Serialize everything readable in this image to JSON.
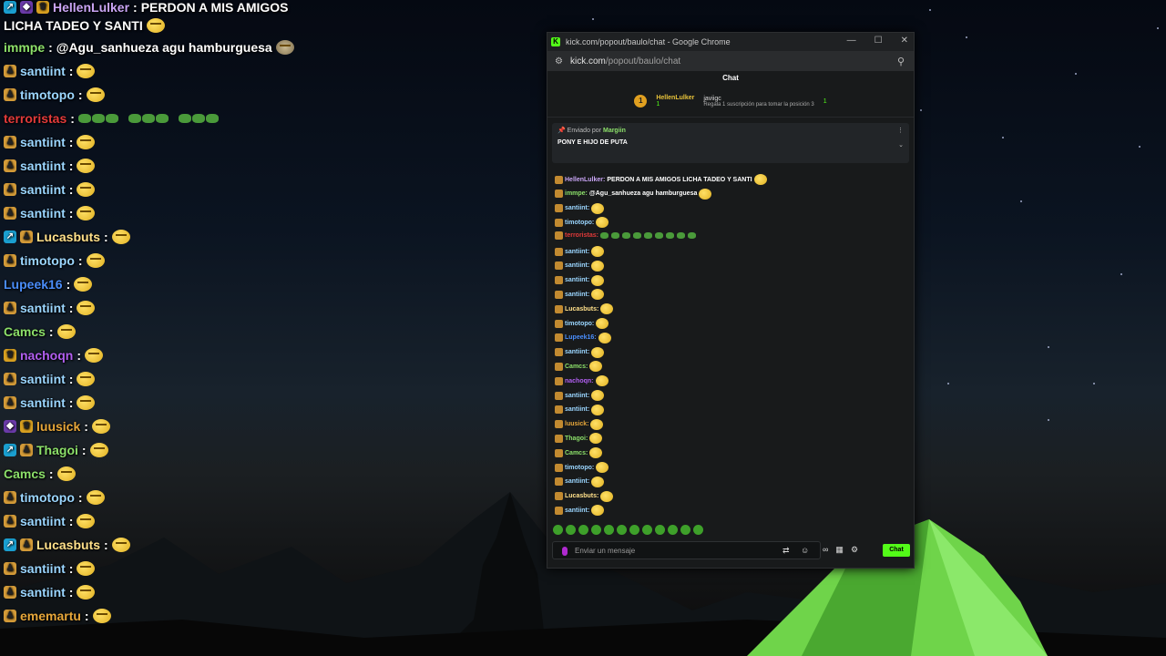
{
  "overlay": [
    {
      "badges": [
        "og",
        "gift",
        "crown"
      ],
      "user": "HellenLulker",
      "color": "#c9a5f5",
      "msg": "PERDON A MIS AMIGOS",
      "msg2": "LICHA TADEO Y SANTI",
      "emote": "smile"
    },
    {
      "badges": [],
      "user": "immpe",
      "color": "#8ce06a",
      "msg": "@Agu_sanhueza agu hamburguesa",
      "emote": "turtle"
    },
    {
      "badges": [
        "vip"
      ],
      "user": "santiint",
      "color": "#9bd6ff",
      "msg": "",
      "emote": "smile"
    },
    {
      "badges": [
        "vip"
      ],
      "user": "timotopo",
      "color": "#9bd6ff",
      "msg": "",
      "emote": "smile"
    },
    {
      "badges": [],
      "user": "terroristas",
      "color": "#e33a3a",
      "msg": "",
      "emote": "frogs"
    },
    {
      "badges": [
        "vip"
      ],
      "user": "santiint",
      "color": "#9bd6ff",
      "msg": "",
      "emote": "smile"
    },
    {
      "badges": [
        "vip"
      ],
      "user": "santiint",
      "color": "#9bd6ff",
      "msg": "",
      "emote": "smile"
    },
    {
      "badges": [
        "vip"
      ],
      "user": "santiint",
      "color": "#9bd6ff",
      "msg": "",
      "emote": "smile"
    },
    {
      "badges": [
        "vip"
      ],
      "user": "santiint",
      "color": "#9bd6ff",
      "msg": "",
      "emote": "smile"
    },
    {
      "badges": [
        "og",
        "vip"
      ],
      "user": "Lucasbuts",
      "color": "#ffe08a",
      "msg": "",
      "emote": "smile"
    },
    {
      "badges": [
        "vip"
      ],
      "user": "timotopo",
      "color": "#9bd6ff",
      "msg": "",
      "emote": "smile"
    },
    {
      "badges": [],
      "user": "Lupeek16",
      "color": "#4a8dfa",
      "msg": "",
      "emote": "smile"
    },
    {
      "badges": [
        "vip"
      ],
      "user": "santiint",
      "color": "#9bd6ff",
      "msg": "",
      "emote": "smile"
    },
    {
      "badges": [],
      "user": "Camcs",
      "color": "#8ce06a",
      "msg": "",
      "emote": "smile"
    },
    {
      "badges": [
        "crown"
      ],
      "user": "nachoqn",
      "color": "#b15ff0",
      "msg": "",
      "emote": "smile"
    },
    {
      "badges": [
        "vip"
      ],
      "user": "santiint",
      "color": "#9bd6ff",
      "msg": "",
      "emote": "smile"
    },
    {
      "badges": [
        "vip"
      ],
      "user": "santiint",
      "color": "#9bd6ff",
      "msg": "",
      "emote": "smile"
    },
    {
      "badges": [
        "gift",
        "crown"
      ],
      "user": "luusick",
      "color": "#e7a73a",
      "msg": "",
      "emote": "smile"
    },
    {
      "badges": [
        "og",
        "vip"
      ],
      "user": "Thagoi",
      "color": "#8ce06a",
      "msg": "",
      "emote": "smile"
    },
    {
      "badges": [],
      "user": "Camcs",
      "color": "#8ce06a",
      "msg": "",
      "emote": "smile"
    },
    {
      "badges": [
        "vip"
      ],
      "user": "timotopo",
      "color": "#9bd6ff",
      "msg": "",
      "emote": "smile"
    },
    {
      "badges": [
        "vip"
      ],
      "user": "santiint",
      "color": "#9bd6ff",
      "msg": "",
      "emote": "smile"
    },
    {
      "badges": [
        "og",
        "vip"
      ],
      "user": "Lucasbuts",
      "color": "#ffe08a",
      "msg": "",
      "emote": "smile"
    },
    {
      "badges": [
        "vip"
      ],
      "user": "santiint",
      "color": "#9bd6ff",
      "msg": "",
      "emote": "smile"
    },
    {
      "badges": [
        "vip"
      ],
      "user": "santiint",
      "color": "#9bd6ff",
      "msg": "",
      "emote": "smile"
    },
    {
      "badges": [
        "vip"
      ],
      "user": "ememartu",
      "color": "#e7a73a",
      "msg": "",
      "emote": "smile"
    }
  ],
  "window": {
    "title": "kick.com/popout/baulo/chat - Google Chrome",
    "url_host": "kick.com",
    "url_path": "/popout/baulo/chat",
    "chat_header": "Chat",
    "leaderboard": {
      "rank": "1",
      "user1": "HellenLulker",
      "user1_sub": "1",
      "user2": "javiigc",
      "user2_sub": "Regala 1 suscripción para tomar la posición 3",
      "count": "1"
    },
    "pinned": {
      "sent_by_label": "Enviado por",
      "sent_by_user": "Margiin",
      "message": "PONY E HIJO DE PUTA"
    },
    "messages": [
      {
        "user": "HellenLulker",
        "color": "#c9a5f5",
        "text": "PERDON A MIS AMIGOS LICHA TADEO Y SANTI"
      },
      {
        "user": "immpe",
        "color": "#8ce06a",
        "text": "@Agu_sanhueza agu hamburguesa"
      },
      {
        "user": "santiint",
        "color": "#9bd6ff",
        "text": ""
      },
      {
        "user": "timotopo",
        "color": "#9bd6ff",
        "text": ""
      },
      {
        "user": "terroristas",
        "color": "#e33a3a",
        "text": ""
      },
      {
        "user": "santiint",
        "color": "#9bd6ff",
        "text": ""
      },
      {
        "user": "santiint",
        "color": "#9bd6ff",
        "text": ""
      },
      {
        "user": "santiint",
        "color": "#9bd6ff",
        "text": ""
      },
      {
        "user": "santiint",
        "color": "#9bd6ff",
        "text": ""
      },
      {
        "user": "Lucasbuts",
        "color": "#ffe08a",
        "text": ""
      },
      {
        "user": "timotopo",
        "color": "#9bd6ff",
        "text": ""
      },
      {
        "user": "Lupeek16",
        "color": "#4a8dfa",
        "text": ""
      },
      {
        "user": "santiint",
        "color": "#9bd6ff",
        "text": ""
      },
      {
        "user": "Camcs",
        "color": "#8ce06a",
        "text": ""
      },
      {
        "user": "nachoqn",
        "color": "#b15ff0",
        "text": ""
      },
      {
        "user": "santiint",
        "color": "#9bd6ff",
        "text": ""
      },
      {
        "user": "santiint",
        "color": "#9bd6ff",
        "text": ""
      },
      {
        "user": "luusick",
        "color": "#e7a73a",
        "text": ""
      },
      {
        "user": "Thagoi",
        "color": "#8ce06a",
        "text": ""
      },
      {
        "user": "Camcs",
        "color": "#8ce06a",
        "text": ""
      },
      {
        "user": "timotopo",
        "color": "#9bd6ff",
        "text": ""
      },
      {
        "user": "santiint",
        "color": "#9bd6ff",
        "text": ""
      },
      {
        "user": "Lucasbuts",
        "color": "#ffe08a",
        "text": ""
      },
      {
        "user": "santiint",
        "color": "#9bd6ff",
        "text": ""
      }
    ],
    "input_placeholder": "Enviar un mensaje",
    "chat_button": "Chat"
  }
}
